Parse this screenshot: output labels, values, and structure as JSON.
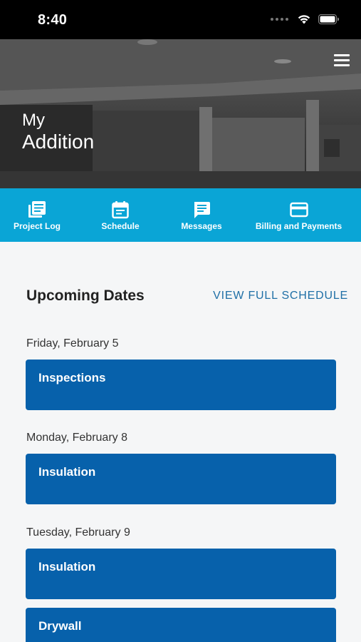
{
  "status_bar": {
    "time": "8:40"
  },
  "header": {
    "title_line1": "My",
    "title_line2": "Addition"
  },
  "tabs": [
    {
      "label": "Project Log",
      "icon": "project-log-icon"
    },
    {
      "label": "Schedule",
      "icon": "calendar-icon"
    },
    {
      "label": "Messages",
      "icon": "message-icon"
    },
    {
      "label": "Billing and Payments",
      "icon": "credit-card-icon"
    }
  ],
  "upcoming": {
    "title": "Upcoming Dates",
    "view_link": "VIEW FULL SCHEDULE",
    "days": [
      {
        "date": "Friday, February 5",
        "events": [
          "Inspections"
        ]
      },
      {
        "date": "Monday, February 8",
        "events": [
          "Insulation"
        ]
      },
      {
        "date": "Tuesday, February 9",
        "events": [
          "Insulation",
          "Drywall"
        ]
      }
    ]
  },
  "colors": {
    "tab_bar": "#0aa5d6",
    "event_card": "#0761ab",
    "link": "#1f6fa6",
    "status_bar": "#000000"
  }
}
